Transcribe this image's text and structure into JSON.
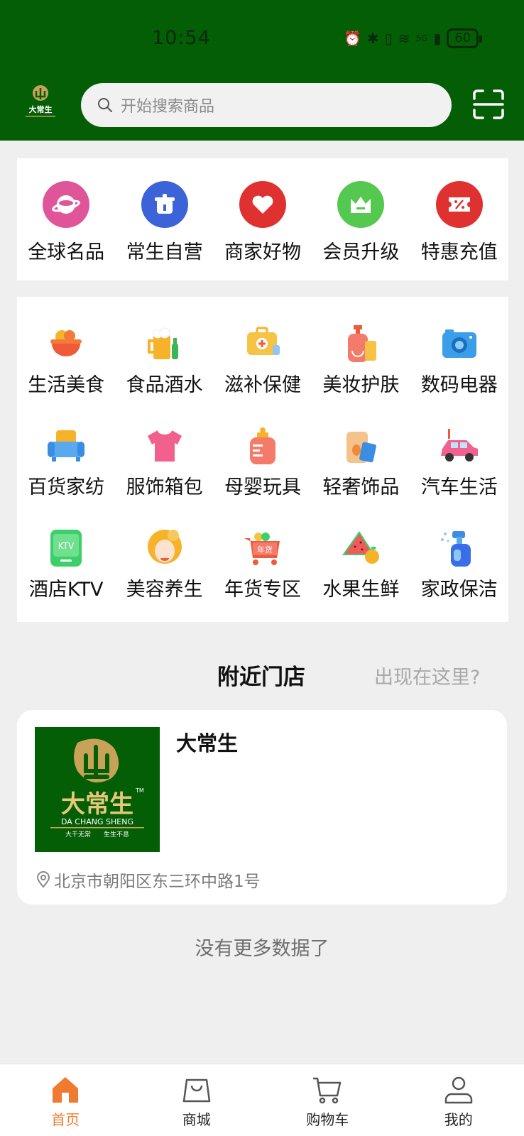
{
  "status_bar": {
    "time": "10:54",
    "battery": "60",
    "network": "5G"
  },
  "header": {
    "logo_text": "大常生",
    "search_placeholder": "开始搜索商品"
  },
  "quick_menu": [
    {
      "label": "全球名品",
      "icon": "planet-icon",
      "color": "#e0559a"
    },
    {
      "label": "常生自营",
      "icon": "pot-icon",
      "color": "#3d63d8"
    },
    {
      "label": "商家好物",
      "icon": "heart-icon",
      "color": "#e03131"
    },
    {
      "label": "会员升级",
      "icon": "crown-icon",
      "color": "#54c84f"
    },
    {
      "label": "特惠充值",
      "icon": "coupon-icon",
      "color": "#e03131"
    }
  ],
  "categories": [
    {
      "label": "生活美食",
      "icon": "food-bowl-icon"
    },
    {
      "label": "食品酒水",
      "icon": "beer-icon"
    },
    {
      "label": "滋补保健",
      "icon": "medical-kit-icon"
    },
    {
      "label": "美妆护肤",
      "icon": "lotion-icon"
    },
    {
      "label": "数码电器",
      "icon": "camera-icon"
    },
    {
      "label": "百货家纺",
      "icon": "sofa-icon"
    },
    {
      "label": "服饰箱包",
      "icon": "tshirt-icon"
    },
    {
      "label": "母婴玩具",
      "icon": "baby-bottle-icon"
    },
    {
      "label": "轻奢饰品",
      "icon": "perfume-icon"
    },
    {
      "label": "汽车生活",
      "icon": "car-icon"
    },
    {
      "label": "酒店KTV",
      "icon": "ktv-icon"
    },
    {
      "label": "美容养生",
      "icon": "beauty-icon"
    },
    {
      "label": "年货专区",
      "icon": "new-year-cart-icon"
    },
    {
      "label": "水果生鲜",
      "icon": "watermelon-icon"
    },
    {
      "label": "家政保洁",
      "icon": "spray-bottle-icon"
    }
  ],
  "nearby": {
    "title": "附近门店",
    "link": "出现在这里?",
    "store": {
      "name": "大常生",
      "logo_text": "大常生",
      "logo_subtext": "DA CHANG SHENG",
      "logo_slogan": "大千无常　　生生不息",
      "address": "北京市朝阳区东三环中路1号"
    },
    "no_more": "没有更多数据了"
  },
  "tabbar": [
    {
      "label": "首页",
      "icon": "home-icon",
      "active": true
    },
    {
      "label": "商城",
      "icon": "shopping-bag-icon",
      "active": false
    },
    {
      "label": "购物车",
      "icon": "cart-icon",
      "active": false
    },
    {
      "label": "我的",
      "icon": "user-icon",
      "active": false
    }
  ],
  "colors": {
    "brand_green": "#035e06",
    "accent_orange": "#f07a2f"
  }
}
